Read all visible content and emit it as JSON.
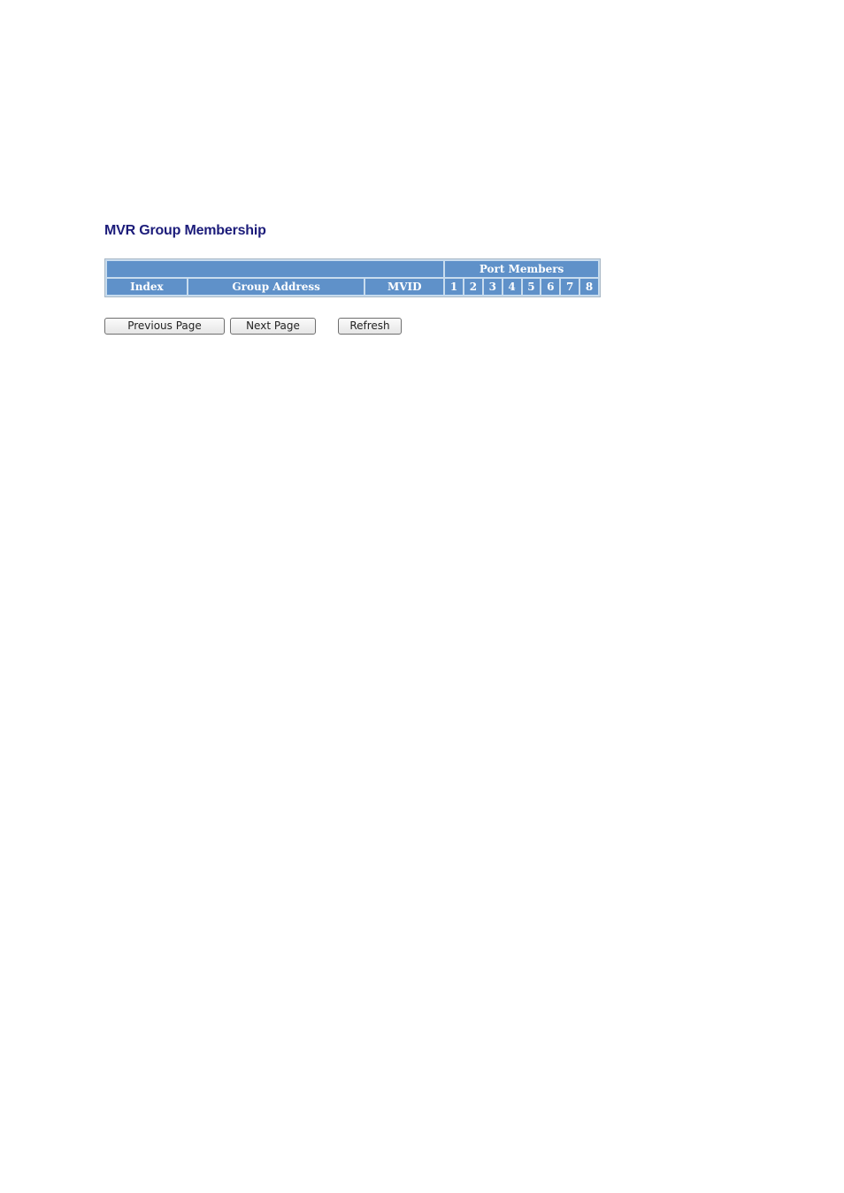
{
  "page": {
    "title": "MVR Group Membership"
  },
  "table": {
    "group_header": "Port Members",
    "columns": {
      "index": "Index",
      "group_address": "Group Address",
      "mvid": "MVID"
    },
    "ports": [
      "1",
      "2",
      "3",
      "4",
      "5",
      "6",
      "7",
      "8"
    ],
    "rows": []
  },
  "buttons": {
    "previous": "Previous Page",
    "next": "Next Page",
    "refresh": "Refresh"
  },
  "colors": {
    "title": "#1c1c7a",
    "header_bg": "#5f91c9",
    "header_text": "#ffffff"
  }
}
